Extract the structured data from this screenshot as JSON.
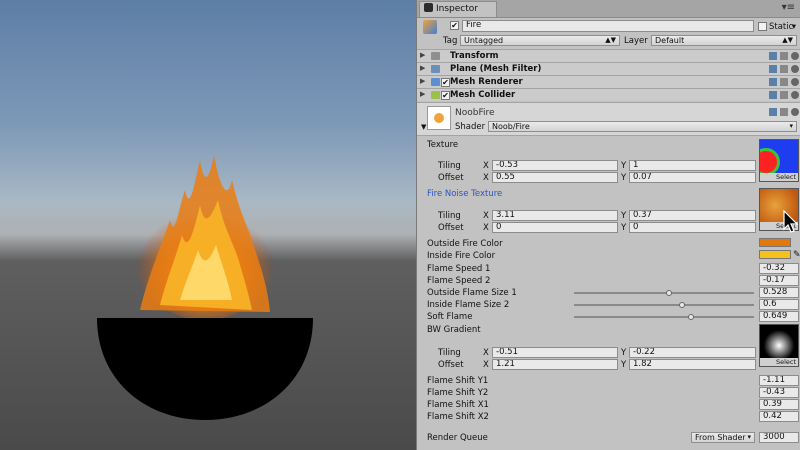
{
  "inspector": {
    "tab_label": "Inspector",
    "object": {
      "enabled": true,
      "name": "Fire",
      "static_label": "Static",
      "tag_label": "Tag",
      "tag_value": "Untagged",
      "layer_label": "Layer",
      "layer_value": "Default"
    },
    "components": [
      {
        "name": "Transform",
        "icon": "transform-icon",
        "checkbox": false
      },
      {
        "name": "Plane (Mesh Filter)",
        "icon": "mesh-filter-icon",
        "checkbox": false
      },
      {
        "name": "Mesh Renderer",
        "icon": "mesh-renderer-icon",
        "checkbox": true
      },
      {
        "name": "Mesh Collider",
        "icon": "mesh-collider-icon",
        "checkbox": true
      }
    ],
    "material": {
      "name": "NoobFire",
      "shader_label": "Shader",
      "shader_value": "Noob/Fire"
    },
    "properties": {
      "texture_label": "Texture",
      "tiling_label": "Tiling",
      "offset_label": "Offset",
      "x_label": "X",
      "y_label": "Y",
      "select_label": "Select",
      "texture": {
        "tiling_x": "-0.53",
        "tiling_y": "1",
        "offset_x": "0.55",
        "offset_y": "0.07"
      },
      "noise_label": "Fire Noise Texture",
      "noise": {
        "tiling_x": "3.11",
        "tiling_y": "0.37",
        "offset_x": "0",
        "offset_y": "0"
      },
      "outside_color_label": "Outside Fire Color",
      "inside_color_label": "Inside Fire Color",
      "flame_speed_1_label": "Flame Speed 1",
      "flame_speed_1": "-0.32",
      "flame_speed_2_label": "Flame Speed 2",
      "flame_speed_2": "-0.17",
      "outside_size_label": "Outside Flame Size 1",
      "outside_size": "0.528",
      "outside_size_fraction": 0.528,
      "inside_size_label": "Inside Flame Size 2",
      "inside_size": "0.6",
      "inside_size_fraction": 0.6,
      "soft_flame_label": "Soft Flame",
      "soft_flame": "0.649",
      "soft_flame_fraction": 0.649,
      "bw_gradient_label": "BW Gradient",
      "bw": {
        "tiling_x": "-0.51",
        "tiling_y": "-0.22",
        "offset_x": "1.21",
        "offset_y": "1.82"
      },
      "shift_y1_label": "Flame Shift Y1",
      "shift_y1": "-1.11",
      "shift_y2_label": "Flame Shift Y2",
      "shift_y2": "-0.43",
      "shift_x1_label": "Flame Shift X1",
      "shift_x1": "0.39",
      "shift_x2_label": "Flame Shift X2",
      "shift_x2": "0.42",
      "render_queue_label": "Render Queue",
      "render_queue_mode": "From Shader",
      "render_queue_value": "3000"
    }
  },
  "colors": {
    "outside_fire": "#e07a10",
    "inside_fire": "#f4c21a",
    "link_label": "#2a55c8"
  }
}
